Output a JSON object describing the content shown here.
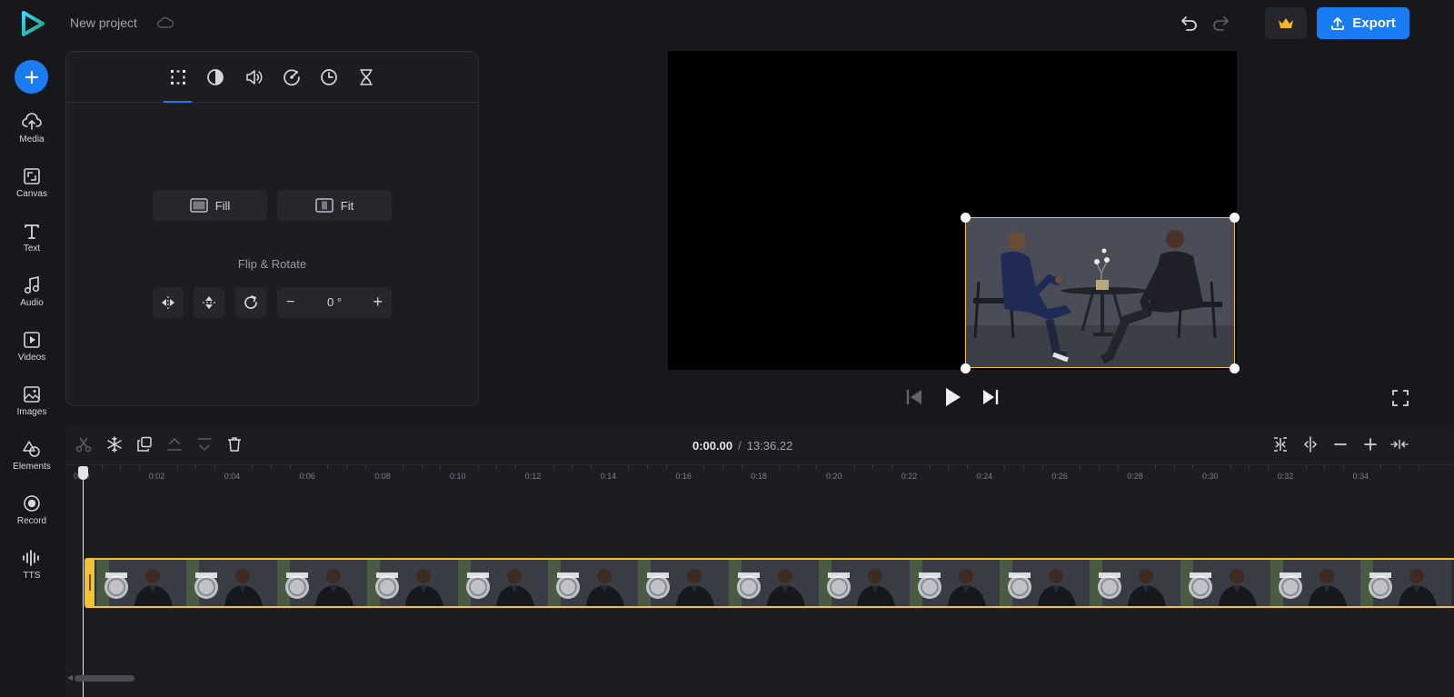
{
  "app": {
    "project_title": "New project",
    "export_label": "Export"
  },
  "rail": {
    "items": [
      {
        "label": "Media",
        "icon": "upload-cloud-icon"
      },
      {
        "label": "Canvas",
        "icon": "canvas-icon"
      },
      {
        "label": "Text",
        "icon": "text-icon"
      },
      {
        "label": "Audio",
        "icon": "music-note-icon"
      },
      {
        "label": "Videos",
        "icon": "video-play-icon"
      },
      {
        "label": "Images",
        "icon": "image-icon"
      },
      {
        "label": "Elements",
        "icon": "shapes-icon"
      },
      {
        "label": "Record",
        "icon": "record-icon"
      },
      {
        "label": "TTS",
        "icon": "waveform-icon"
      }
    ]
  },
  "panel": {
    "tabs": [
      "transform-icon",
      "color-adjust-icon",
      "volume-icon",
      "speed-icon",
      "clock-icon",
      "hourglass-icon"
    ],
    "active_tab": 0,
    "fill_label": "Fill",
    "fit_label": "Fit",
    "flip_rotate_title": "Flip & Rotate",
    "rotation_value": "0 °",
    "minus": "−",
    "plus": "+"
  },
  "timeline": {
    "current_time": "0:00.00",
    "separator": "/",
    "total_time": "13:36.22",
    "ruler_labels": [
      "0:00",
      "0:02",
      "0:04",
      "0:06",
      "0:08",
      "0:10",
      "0:12",
      "0:14",
      "0:16",
      "0:18",
      "0:20",
      "0:22",
      "0:24",
      "0:26",
      "0:28",
      "0:30",
      "0:32",
      "0:34"
    ]
  },
  "colors": {
    "accent": "#1a7cf5",
    "selection": "#f2c230",
    "background": "#17171c",
    "panel": "#1c1c21"
  }
}
